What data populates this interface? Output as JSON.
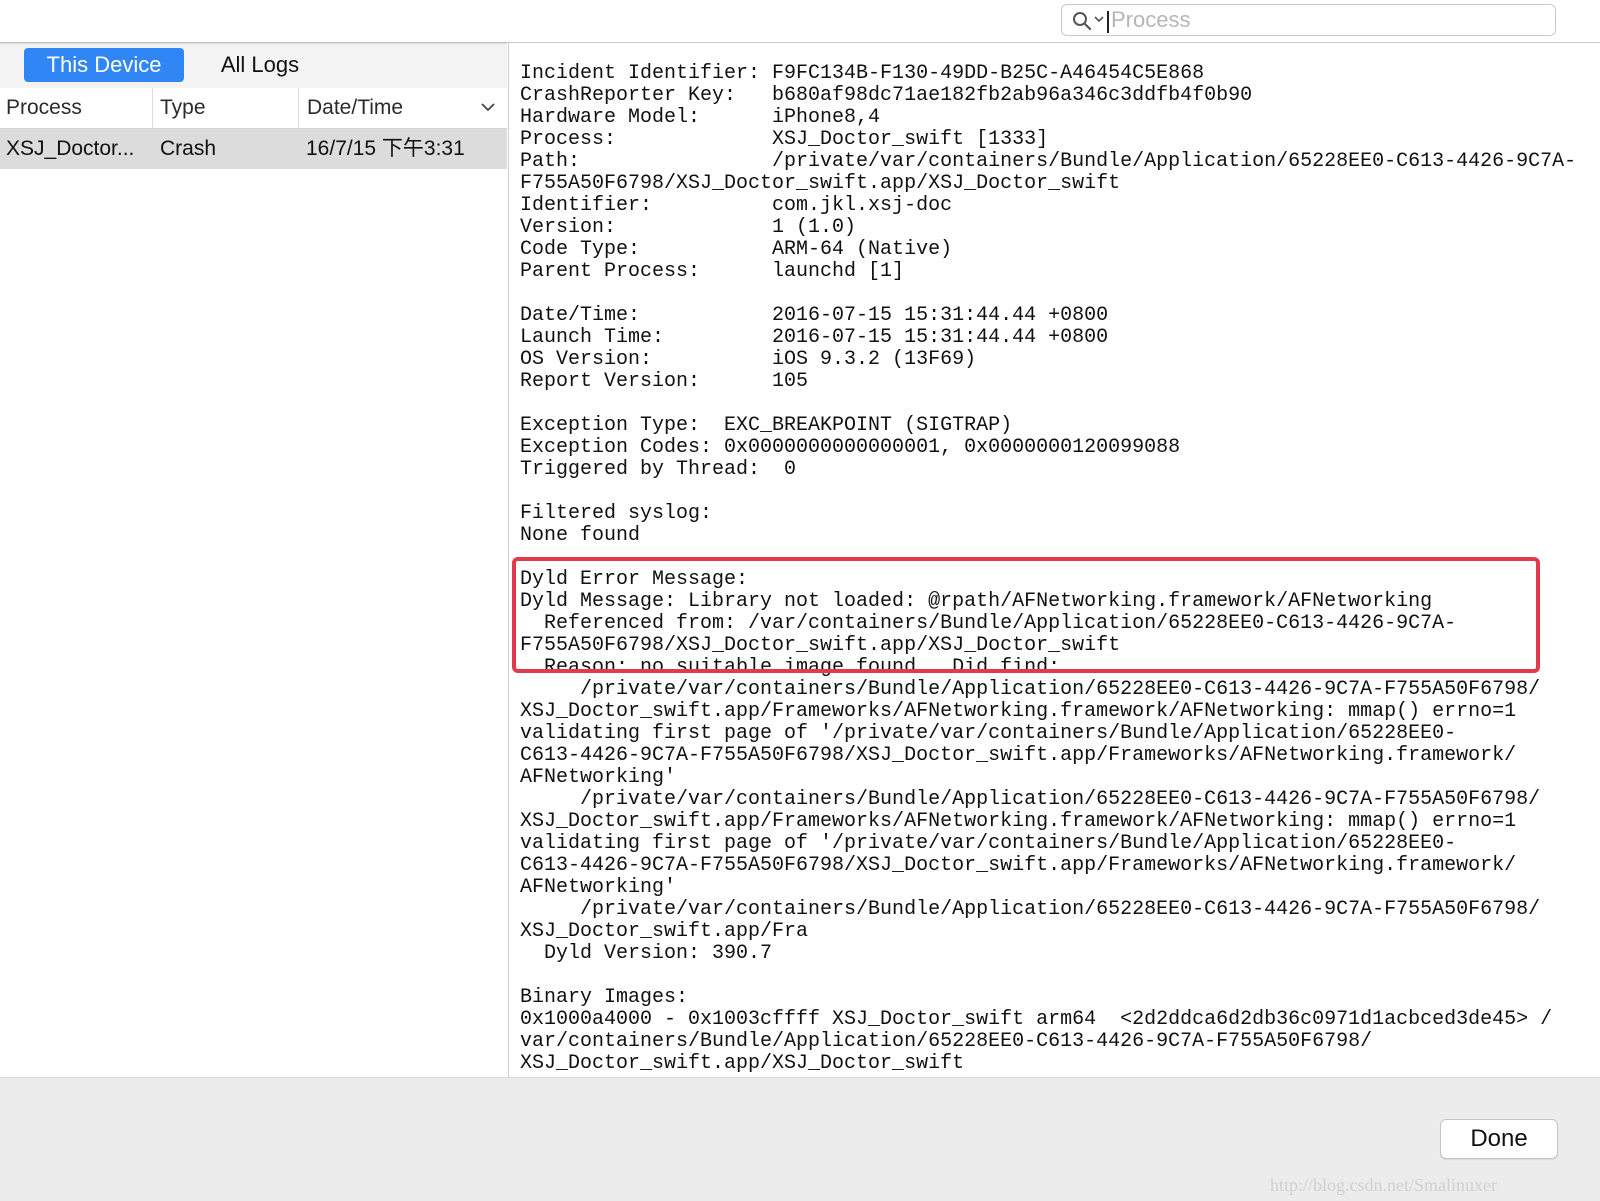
{
  "search": {
    "placeholder": "Process",
    "value": ""
  },
  "segments": {
    "active": "This Device",
    "inactive": "All Logs"
  },
  "columns": {
    "process": "Process",
    "type": "Type",
    "date": "Date/Time"
  },
  "rows": [
    {
      "process": "XSJ_Doctor...",
      "type": "Crash",
      "date": "16/7/15 下午3:31"
    }
  ],
  "log": {
    "text": "Incident Identifier: F9FC134B-F130-49DD-B25C-A46454C5E868\nCrashReporter Key:   b680af98dc71ae182fb2ab96a346c3ddfb4f0b90\nHardware Model:      iPhone8,4\nProcess:             XSJ_Doctor_swift [1333]\nPath:                /private/var/containers/Bundle/Application/65228EE0-C613-4426-9C7A-\nF755A50F6798/XSJ_Doctor_swift.app/XSJ_Doctor_swift\nIdentifier:          com.jkl.xsj-doc\nVersion:             1 (1.0)\nCode Type:           ARM-64 (Native)\nParent Process:      launchd [1]\n\nDate/Time:           2016-07-15 15:31:44.44 +0800\nLaunch Time:         2016-07-15 15:31:44.44 +0800\nOS Version:          iOS 9.3.2 (13F69)\nReport Version:      105\n\nException Type:  EXC_BREAKPOINT (SIGTRAP)\nException Codes: 0x0000000000000001, 0x0000000120099088\nTriggered by Thread:  0\n\nFiltered syslog:\nNone found\n\nDyld Error Message:\nDyld Message: Library not loaded: @rpath/AFNetworking.framework/AFNetworking\n  Referenced from: /var/containers/Bundle/Application/65228EE0-C613-4426-9C7A-\nF755A50F6798/XSJ_Doctor_swift.app/XSJ_Doctor_swift\n  Reason: no suitable image found.  Did find:\n     /private/var/containers/Bundle/Application/65228EE0-C613-4426-9C7A-F755A50F6798/\nXSJ_Doctor_swift.app/Frameworks/AFNetworking.framework/AFNetworking: mmap() errno=1\nvalidating first page of '/private/var/containers/Bundle/Application/65228EE0-\nC613-4426-9C7A-F755A50F6798/XSJ_Doctor_swift.app/Frameworks/AFNetworking.framework/\nAFNetworking'\n     /private/var/containers/Bundle/Application/65228EE0-C613-4426-9C7A-F755A50F6798/\nXSJ_Doctor_swift.app/Frameworks/AFNetworking.framework/AFNetworking: mmap() errno=1\nvalidating first page of '/private/var/containers/Bundle/Application/65228EE0-\nC613-4426-9C7A-F755A50F6798/XSJ_Doctor_swift.app/Frameworks/AFNetworking.framework/\nAFNetworking'\n     /private/var/containers/Bundle/Application/65228EE0-C613-4426-9C7A-F755A50F6798/\nXSJ_Doctor_swift.app/Fra\n  Dyld Version: 390.7\n\nBinary Images:\n0x1000a4000 - 0x1003cffff XSJ_Doctor_swift arm64  <2d2ddca6d2db36c0971d1acbced3de45> /\nvar/containers/Bundle/Application/65228EE0-C613-4426-9C7A-F755A50F6798/\nXSJ_Doctor_swift.app/XSJ_Doctor_swift"
  },
  "footer": {
    "done_label": "Done",
    "watermark": "http://blog.csdn.net/Smalinuxer"
  },
  "colors": {
    "accent": "#2f86f4",
    "highlight": "#e23a4a",
    "selected_row": "#dcdcdc"
  },
  "icons": {
    "search": "magnifier-icon",
    "search_options": "chevron-down-icon",
    "sort": "chevron-down-icon"
  }
}
